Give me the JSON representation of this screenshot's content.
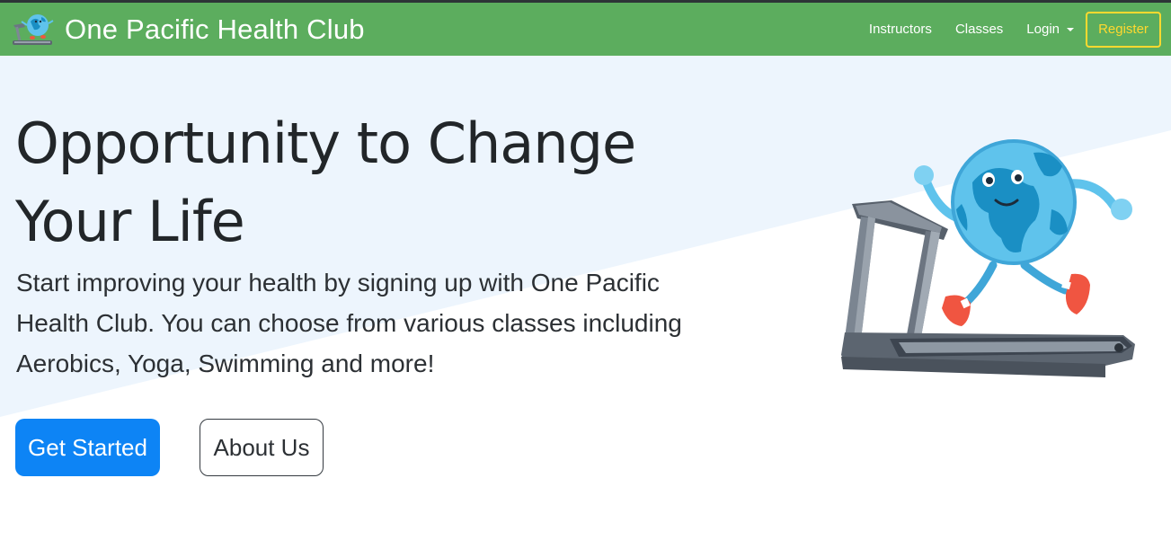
{
  "brand": {
    "name": "One Pacific Health Club",
    "logo_icon": "globe-treadmill-logo-icon"
  },
  "nav": {
    "items": [
      {
        "label": "Instructors"
      },
      {
        "label": "Classes"
      },
      {
        "label": "Login",
        "has_dropdown": true
      }
    ],
    "register_label": "Register"
  },
  "hero": {
    "title": "Opportunity to Change Your Life",
    "text": "Start improving your health by signing up with One Pacific Health Club. You can choose from various classes including Aerobics, Yoga, Swimming and more!",
    "primary_button": "Get Started",
    "secondary_button": "About Us",
    "illustration_icon": "globe-running-on-treadmill-illustration"
  },
  "colors": {
    "navbar": "#5cad5e",
    "register_accent": "#ffd92f",
    "primary_button": "#0d84f5",
    "hero_background": "#edf5fd"
  }
}
